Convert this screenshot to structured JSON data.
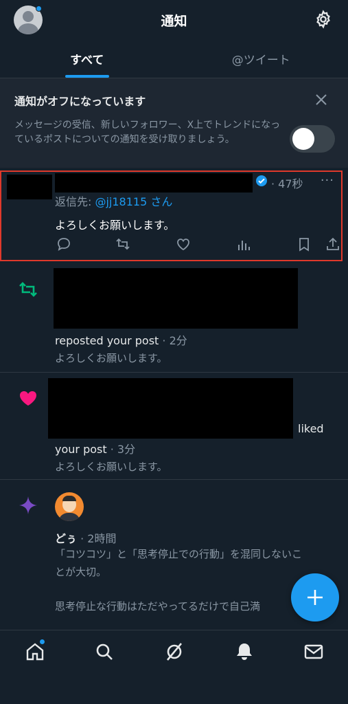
{
  "header": {
    "title": "通知"
  },
  "tabs": [
    {
      "label": "すべて",
      "active": true
    },
    {
      "label": "@ツイート",
      "active": false
    }
  ],
  "banner": {
    "title": "通知がオフになっています",
    "text": "メッセージの受信、新しいフォロワー、X上でトレンドになっているポストについての通知を受け取りましょう。",
    "toggle_on": false
  },
  "notifications": [
    {
      "type": "reply",
      "time": "47秒",
      "more": "···",
      "reply_prefix": "返信先: ",
      "reply_handle": "@jj18115 さん",
      "text": "よろしくお願いします。"
    },
    {
      "type": "repost",
      "action": "reposted your post",
      "time": " · 2分",
      "post": "よろしくお願いします。"
    },
    {
      "type": "like",
      "action_a": "liked",
      "action_b": "your post",
      "time": " · 3分",
      "post": "よろしくお願いします。"
    },
    {
      "type": "recommended",
      "author": "どぅ",
      "time": " · 2時間",
      "line1": "「コツコツ」と「思考停止での行動」を混同しないこ",
      "line2": "とが大切。",
      "line3": "思考停止な行動はただやってるだけで自己満"
    }
  ],
  "colors": {
    "accent": "#1d9bf0",
    "like": "#f91880",
    "repost": "#00ba7c",
    "spark": "#794bc4",
    "background": "#15202b"
  }
}
